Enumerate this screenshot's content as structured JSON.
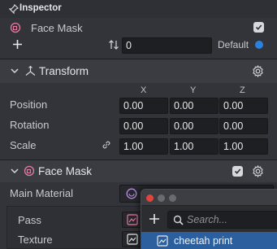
{
  "inspector": {
    "title": "Inspector",
    "object_name": "Face Mask",
    "layer_value": "0",
    "default_label": "Default"
  },
  "transform": {
    "title": "Transform",
    "axes": [
      "X",
      "Y",
      "Z"
    ],
    "rows": [
      {
        "label": "Position",
        "values": [
          "0.00",
          "0.00",
          "0.00"
        ]
      },
      {
        "label": "Rotation",
        "values": [
          "0.00",
          "0.00",
          "0.00"
        ]
      },
      {
        "label": "Scale",
        "values": [
          "1.00",
          "1.00",
          "1.00"
        ]
      }
    ]
  },
  "face_mask": {
    "title": "Face Mask",
    "main_material_label": "Main Material",
    "pass_label": "Pass",
    "texture_label": "Texture"
  },
  "popup": {
    "search_placeholder": "Search...",
    "selected_item": "cheetah print"
  },
  "colors": {
    "accent_blue": "#2a82e0",
    "selection": "#2c5f9e",
    "dot_close": "#e0443e",
    "dot_min": "#6a6b70",
    "dot_max": "#6a6b70"
  }
}
